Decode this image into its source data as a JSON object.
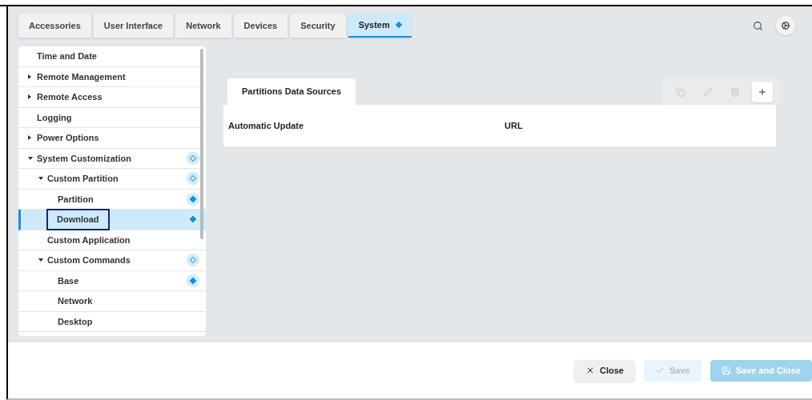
{
  "tabs": [
    {
      "label": "Accessories",
      "selected": false,
      "modified": false
    },
    {
      "label": "User Interface",
      "selected": false,
      "modified": false
    },
    {
      "label": "Network",
      "selected": false,
      "modified": false
    },
    {
      "label": "Devices",
      "selected": false,
      "modified": false
    },
    {
      "label": "Security",
      "selected": false,
      "modified": false
    },
    {
      "label": "System",
      "selected": true,
      "modified": true
    }
  ],
  "tree": [
    {
      "label": "Time and Date",
      "selected": false,
      "modified": false,
      "contains_modified": false
    },
    {
      "label": "Remote Management",
      "selected": false,
      "modified": false,
      "contains_modified": false,
      "expanded": false
    },
    {
      "label": "Remote Access",
      "selected": false,
      "modified": false,
      "contains_modified": false,
      "expanded": false
    },
    {
      "label": "Logging",
      "selected": false,
      "modified": false,
      "contains_modified": false
    },
    {
      "label": "Power Options",
      "selected": false,
      "modified": false,
      "contains_modified": false,
      "expanded": false
    },
    {
      "label": "System Customization",
      "selected": false,
      "modified": false,
      "contains_modified": true,
      "expanded": true,
      "children": [
        {
          "label": "Custom Partition",
          "selected": false,
          "modified": false,
          "contains_modified": true,
          "expanded": true,
          "children": [
            {
              "label": "Partition",
              "selected": false,
              "modified": true,
              "contains_modified": false
            },
            {
              "label": "Download",
              "selected": true,
              "modified": true,
              "contains_modified": false
            }
          ]
        },
        {
          "label": "Custom Application",
          "selected": false,
          "modified": false,
          "contains_modified": false
        },
        {
          "label": "Custom Commands",
          "selected": false,
          "modified": false,
          "contains_modified": true,
          "expanded": true,
          "children": [
            {
              "label": "Base",
              "selected": false,
              "modified": true,
              "contains_modified": false
            },
            {
              "label": "Network",
              "selected": false,
              "modified": false,
              "contains_modified": false
            },
            {
              "label": "Desktop",
              "selected": false,
              "modified": false,
              "contains_modified": false
            }
          ]
        }
      ]
    }
  ],
  "panel": {
    "tab": "Partitions Data Sources",
    "tools": [
      {
        "kind": "copy",
        "disabled": true
      },
      {
        "kind": "edit",
        "disabled": true
      },
      {
        "kind": "delete",
        "disabled": true
      },
      {
        "kind": "add",
        "disabled": false
      }
    ],
    "columns": [
      "Automatic Update",
      "URL"
    ]
  },
  "footer": [
    {
      "kind": "close",
      "label": "Close",
      "disabled": false
    },
    {
      "kind": "save",
      "label": "Save",
      "disabled": true
    },
    {
      "kind": "save-close",
      "label": "Save and Close",
      "disabled": true
    }
  ]
}
